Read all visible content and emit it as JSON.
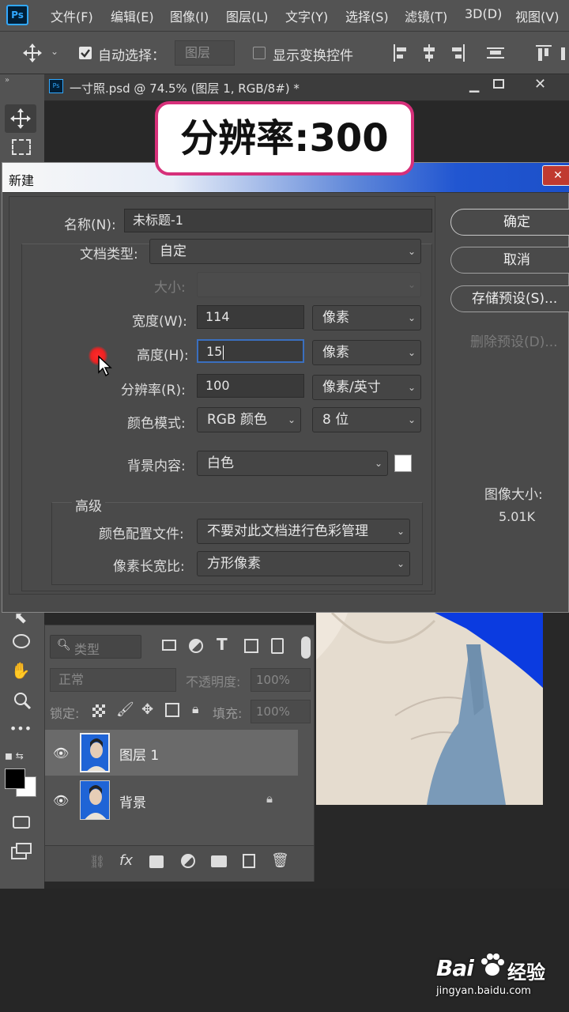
{
  "app": {
    "logo": "Ps"
  },
  "menubar": {
    "items": [
      "文件(F)",
      "编辑(E)",
      "图像(I)",
      "图层(L)",
      "文字(Y)",
      "选择(S)",
      "滤镜(T)",
      "3D(D)",
      "视图(V)"
    ]
  },
  "options": {
    "auto_select_label": "自动选择：",
    "auto_select_value": "图层",
    "show_transform_label": "显示变换控件"
  },
  "document": {
    "tab_title": "一寸照.psd @ 74.5% (图层 1, RGB/8#) *",
    "logo": "Ps"
  },
  "overlay": {
    "text": "分辨率:300"
  },
  "dialog": {
    "title": "新建",
    "name_label": "名称(N):",
    "name_value": "未标题-1",
    "doctype_label": "文档类型:",
    "doctype_value": "自定",
    "size_label": "大小:",
    "width_label": "宽度(W):",
    "width_value": "114",
    "width_unit": "像素",
    "height_label": "高度(H):",
    "height_value": "15",
    "height_unit": "像素",
    "resolution_label": "分辨率(R):",
    "resolution_value": "100",
    "resolution_unit": "像素/英寸",
    "color_mode_label": "颜色模式:",
    "color_mode_value": "RGB 颜色",
    "bit_depth": "8 位",
    "bg_label": "背景内容:",
    "bg_value": "白色",
    "advanced_label": "高级",
    "profile_label": "颜色配置文件:",
    "profile_value": "不要对此文档进行色彩管理",
    "pixel_aspect_label": "像素长宽比:",
    "pixel_aspect_value": "方形像素",
    "ok_button": "确定",
    "cancel_button": "取消",
    "save_preset_button": "存储预设(S)...",
    "delete_preset_button": "删除预设(D)...",
    "image_size_label": "图像大小:",
    "image_size_value": "5.01K"
  },
  "layers_panel": {
    "filter_label": "类型",
    "blend_mode": "正常",
    "opacity_label": "不透明度:",
    "opacity_value": "100%",
    "lock_label": "锁定:",
    "fill_label": "填充:",
    "fill_value": "100%",
    "layers": [
      {
        "name": "图层 1",
        "selected": true
      },
      {
        "name": "背景",
        "locked": true
      }
    ]
  },
  "watermark": {
    "brand_left": "Bai",
    "brand_right": "经验",
    "url": "jingyan.baidu.com"
  },
  "colors": {
    "accent": "#31a8ff",
    "badge_border": "#d6307a",
    "photo_bg": "#1f64d6",
    "title_blue": "#2156d1"
  }
}
